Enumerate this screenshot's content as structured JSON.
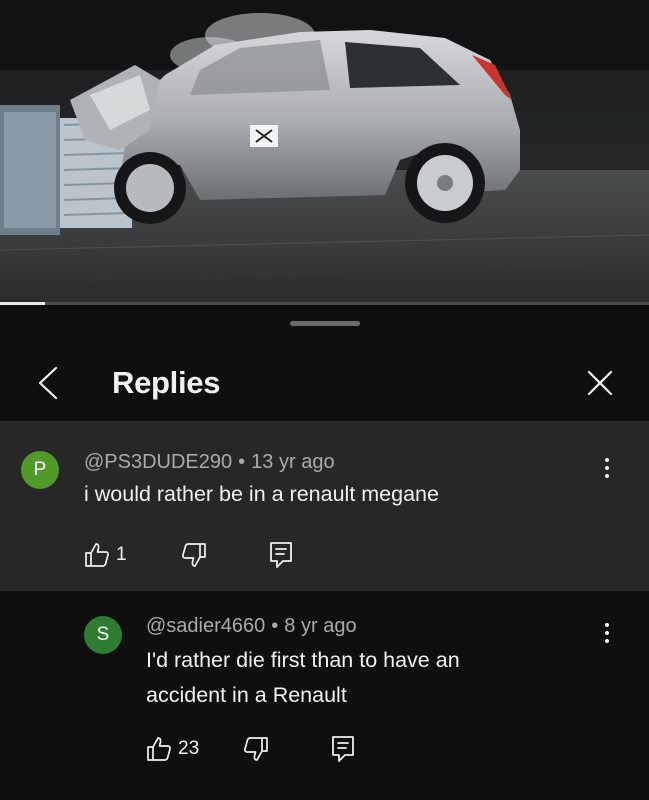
{
  "header": {
    "title": "Replies"
  },
  "parent_comment": {
    "avatar_letter": "P",
    "avatar_color": "#519a2a",
    "author": "@PS3DUDE290",
    "separator": "•",
    "age": "13 yr ago",
    "text": "i would rather be in a renault megane",
    "like_count": "1"
  },
  "reply": {
    "avatar_letter": "S",
    "avatar_color": "#2e7d32",
    "author": "@sadier4660",
    "separator": "•",
    "age": "8 yr ago",
    "text_line1": "I'd rather die first than to have an",
    "text_line2": "accident in a Renault",
    "like_count": "23"
  },
  "video": {
    "progress_fraction": 0.07
  },
  "icons": {
    "back": "chevron-left-icon",
    "close": "close-icon",
    "more": "more-vertical-icon",
    "like": "thumbs-up-icon",
    "dislike": "thumbs-down-icon",
    "reply": "reply-comment-icon"
  }
}
